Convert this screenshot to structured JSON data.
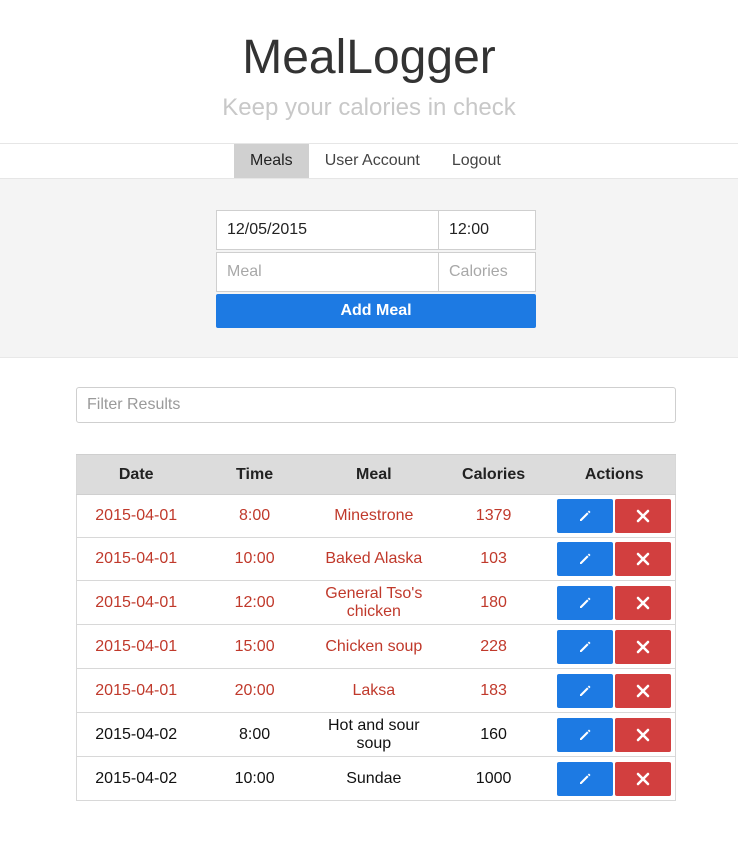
{
  "app": {
    "title": "MealLogger",
    "subtitle": "Keep your calories in check"
  },
  "nav": {
    "items": [
      {
        "label": "Meals",
        "active": true
      },
      {
        "label": "User Account",
        "active": false
      },
      {
        "label": "Logout",
        "active": false
      }
    ]
  },
  "form": {
    "date_value": "12/05/2015",
    "time_value": "12:00",
    "meal_placeholder": "Meal",
    "calories_placeholder": "Calories",
    "add_label": "Add Meal"
  },
  "filter": {
    "placeholder": "Filter Results"
  },
  "table": {
    "headers": [
      "Date",
      "Time",
      "Meal",
      "Calories",
      "Actions"
    ],
    "rows": [
      {
        "date": "2015-04-01",
        "time": "8:00",
        "meal": "Minestrone",
        "calories": "1379",
        "over_limit": true
      },
      {
        "date": "2015-04-01",
        "time": "10:00",
        "meal": "Baked Alaska",
        "calories": "103",
        "over_limit": true
      },
      {
        "date": "2015-04-01",
        "time": "12:00",
        "meal": "General Tso's chicken",
        "calories": "180",
        "over_limit": true
      },
      {
        "date": "2015-04-01",
        "time": "15:00",
        "meal": "Chicken soup",
        "calories": "228",
        "over_limit": true
      },
      {
        "date": "2015-04-01",
        "time": "20:00",
        "meal": "Laksa",
        "calories": "183",
        "over_limit": true
      },
      {
        "date": "2015-04-02",
        "time": "8:00",
        "meal": "Hot and sour soup",
        "calories": "160",
        "over_limit": false
      },
      {
        "date": "2015-04-02",
        "time": "10:00",
        "meal": "Sundae",
        "calories": "1000",
        "over_limit": false
      }
    ]
  },
  "icons": {
    "edit": "pencil-icon",
    "delete": "close-icon"
  },
  "colors": {
    "primary": "#1d7ae3",
    "danger": "#d23f3f",
    "over_limit_text": "#c0392b"
  }
}
